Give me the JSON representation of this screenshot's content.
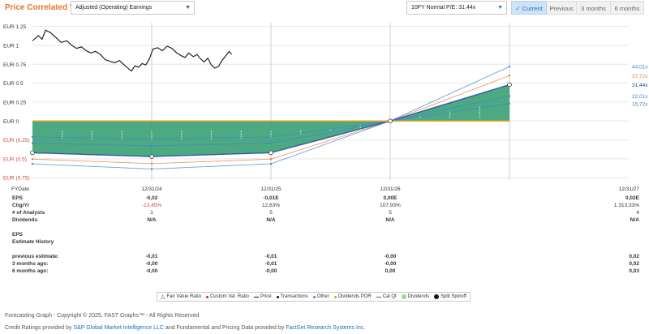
{
  "header": {
    "title": "Price Correlated With",
    "earnings_select": "Adjusted (Operating) Earnings",
    "pe_select": "10FY Normal P/E: 31.44x",
    "tabs": [
      "Current",
      "Previous",
      "3 months",
      "6 months"
    ],
    "active_tab": "Current"
  },
  "colors": {
    "title": "#e8762b",
    "active_tab_bg": "#cfe3f7",
    "fill": "#2e9a6b",
    "normal_pe_line": "#1f4aa8",
    "dividends": "#e8a21a",
    "red": "#d0453a"
  },
  "chart_data": {
    "type": "line",
    "y_axis": {
      "ticks": [
        "EUR 1.25",
        "EUR 1",
        "EUR 0.75",
        "EUR 0.5",
        "EUR 0.25",
        "EUR 0",
        "EUR (0.25)",
        "EUR (0.5)",
        "EUR (0.75)"
      ],
      "tick_values": [
        1.25,
        1,
        0.75,
        0.5,
        0.25,
        0,
        -0.25,
        -0.5,
        -0.75
      ],
      "ylim": [
        -0.78,
        1.3
      ]
    },
    "x_axis": {
      "label": "FYDate",
      "dates": [
        "12/31/24",
        "12/31/25",
        "12/31/26",
        "12/31/27"
      ],
      "domain": [
        2023.0,
        2028.0
      ],
      "vlines": [
        2024.0,
        2025.0,
        2026.0,
        2027.0
      ]
    },
    "pe_lines": [
      {
        "name": "44,01x",
        "end": 0.72
      },
      {
        "name": "37,72x",
        "end": 0.6
      },
      {
        "name": "31,44x",
        "end": 0.48
      },
      {
        "name": "22,01x",
        "end": 0.33
      },
      {
        "name": "15,72x",
        "end": 0.23
      }
    ],
    "pe_line_colors": [
      "#3f86d8",
      "#e8823a",
      "#1f4aa8",
      "#3f86d8",
      "#3f86d8"
    ],
    "pe_line_start_scale": [
      1.35,
      1.2,
      1.0,
      0.7,
      0.5
    ],
    "eps_points": [
      {
        "x": 2023.0,
        "y": -0.42
      },
      {
        "x": 2024.0,
        "y": -0.47
      },
      {
        "x": 2025.0,
        "y": -0.42
      },
      {
        "x": 2026.0,
        "y": 0.0
      },
      {
        "x": 2027.0,
        "y": 0.48
      }
    ],
    "dividends_level": 0.0,
    "price": [
      {
        "x": 2023.0,
        "y": 1.06
      },
      {
        "x": 2023.05,
        "y": 1.13
      },
      {
        "x": 2023.08,
        "y": 1.08
      },
      {
        "x": 2023.11,
        "y": 1.2
      },
      {
        "x": 2023.15,
        "y": 1.17
      },
      {
        "x": 2023.2,
        "y": 1.1
      },
      {
        "x": 2023.24,
        "y": 1.04
      },
      {
        "x": 2023.29,
        "y": 1.06
      },
      {
        "x": 2023.33,
        "y": 1.0
      },
      {
        "x": 2023.37,
        "y": 0.96
      },
      {
        "x": 2023.41,
        "y": 0.98
      },
      {
        "x": 2023.45,
        "y": 0.93
      },
      {
        "x": 2023.49,
        "y": 0.9
      },
      {
        "x": 2023.53,
        "y": 0.92
      },
      {
        "x": 2023.57,
        "y": 0.88
      },
      {
        "x": 2023.61,
        "y": 0.81
      },
      {
        "x": 2023.65,
        "y": 0.79
      },
      {
        "x": 2023.69,
        "y": 0.77
      },
      {
        "x": 2023.73,
        "y": 0.8
      },
      {
        "x": 2023.77,
        "y": 0.74
      },
      {
        "x": 2023.8,
        "y": 0.7
      },
      {
        "x": 2023.83,
        "y": 0.66
      },
      {
        "x": 2023.86,
        "y": 0.73
      },
      {
        "x": 2023.89,
        "y": 0.71
      },
      {
        "x": 2023.92,
        "y": 0.76
      },
      {
        "x": 2023.95,
        "y": 0.74
      },
      {
        "x": 2023.98,
        "y": 0.82
      },
      {
        "x": 2024.01,
        "y": 0.95
      },
      {
        "x": 2024.05,
        "y": 0.97
      },
      {
        "x": 2024.09,
        "y": 0.93
      },
      {
        "x": 2024.13,
        "y": 0.99
      },
      {
        "x": 2024.17,
        "y": 0.96
      },
      {
        "x": 2024.21,
        "y": 0.9
      },
      {
        "x": 2024.25,
        "y": 0.86
      },
      {
        "x": 2024.28,
        "y": 0.84
      },
      {
        "x": 2024.31,
        "y": 0.9
      },
      {
        "x": 2024.35,
        "y": 0.85
      },
      {
        "x": 2024.38,
        "y": 0.88
      },
      {
        "x": 2024.41,
        "y": 0.82
      },
      {
        "x": 2024.44,
        "y": 0.78
      },
      {
        "x": 2024.47,
        "y": 0.83
      },
      {
        "x": 2024.5,
        "y": 0.74
      },
      {
        "x": 2024.53,
        "y": 0.7
      },
      {
        "x": 2024.56,
        "y": 0.72
      },
      {
        "x": 2024.59,
        "y": 0.8
      },
      {
        "x": 2024.62,
        "y": 0.86
      },
      {
        "x": 2024.65,
        "y": 0.92
      },
      {
        "x": 2024.67,
        "y": 0.88
      }
    ]
  },
  "table": {
    "rows": [
      {
        "label": "EPS",
        "values": [
          "-0,02",
          "-0,01E",
          "0,00E",
          "0,02E"
        ],
        "style": "bold"
      },
      {
        "label": "Chg/Yr",
        "values": [
          "-13,45%",
          "12,63%",
          "107,93%",
          "1.313,33%"
        ],
        "first_red": true
      },
      {
        "label": "# of Analysts",
        "values": [
          "1",
          "5",
          "5",
          "4"
        ]
      },
      {
        "label": "Dividends",
        "values": [
          "N/A",
          "N/A",
          "N/A",
          "N/A"
        ],
        "style": "bold"
      },
      {
        "label": "EPS",
        "values": [
          "",
          "",
          "",
          ""
        ]
      },
      {
        "label": "Estimate History",
        "values": [
          "",
          "",
          "",
          ""
        ]
      },
      {
        "label": "previous estimate:",
        "values": [
          "-0,01",
          "-0,01",
          "-0,00",
          "0,02"
        ]
      },
      {
        "label": "3 months ago:",
        "values": [
          "-0,00",
          "-0,01",
          "-0,00",
          "0,02"
        ]
      },
      {
        "label": "6 months ago:",
        "values": [
          "-0,00",
          "-0,00",
          "0,00",
          "0,03"
        ]
      }
    ]
  },
  "legend": [
    {
      "label": "Fair Value Ratio",
      "icon": "triangle-outline-icon",
      "color": "#333333"
    },
    {
      "label": "Custom Val. Ratio",
      "icon": "dot-icon",
      "color": "#c020a0"
    },
    {
      "label": "Price",
      "icon": "line-icon",
      "color": "#111111"
    },
    {
      "label": "Transactions",
      "icon": "dot-icon",
      "color": "#111111"
    },
    {
      "label": "Other",
      "icon": "dot-icon",
      "color": "#3f86d8"
    },
    {
      "label": "Dividends POR",
      "icon": "dot-icon",
      "color": "#e8a21a"
    },
    {
      "label": "Cal Qt",
      "icon": "line-icon",
      "color": "#2e7d32"
    },
    {
      "label": "Dividends",
      "icon": "circle-icon",
      "color": "#9ad79a"
    },
    {
      "label": "Split Spinoff",
      "icon": "circle-icon",
      "color": "#111111"
    }
  ],
  "footer": {
    "line1": "Forecasting Graph - Copyright © 2025, FAST Graphs™ - All Rights Reserved",
    "line2_a": "Credit Ratings provided by ",
    "line2_b": "S&P Global Market Intelligence LLC",
    "line2_c": " and Fundamental and Pricing Data provided by ",
    "line2_d": "FactSet Research Systems Inc."
  }
}
